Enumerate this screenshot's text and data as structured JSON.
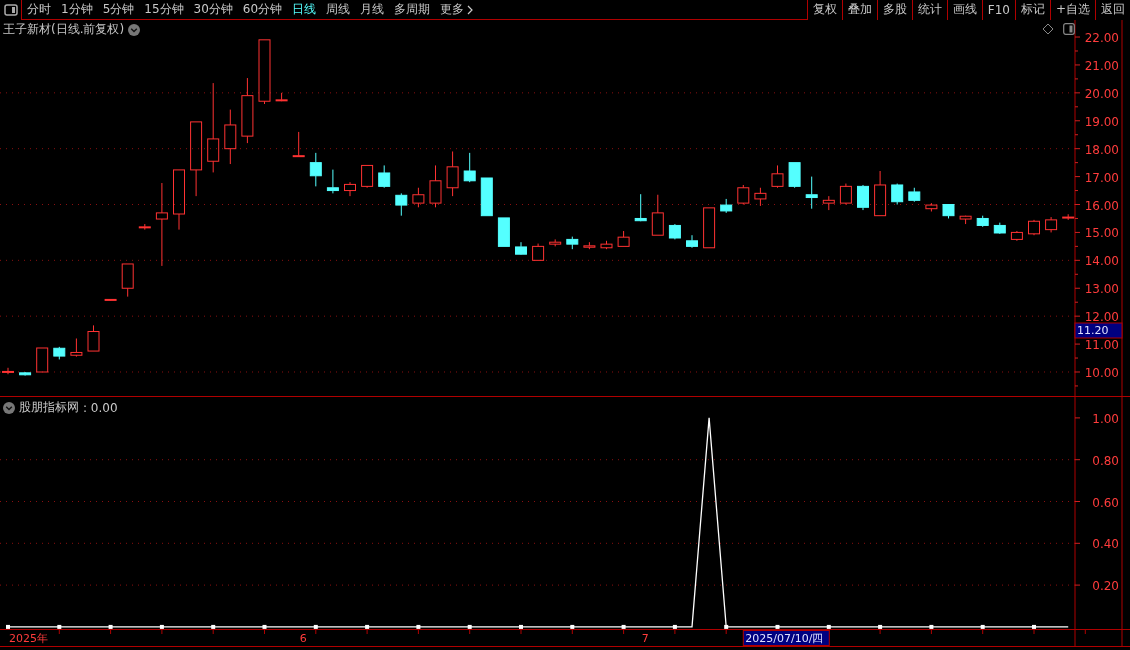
{
  "toolbar": {
    "periods": [
      {
        "label": "分时",
        "selected": false
      },
      {
        "label": "1分钟",
        "selected": false
      },
      {
        "label": "5分钟",
        "selected": false
      },
      {
        "label": "15分钟",
        "selected": false
      },
      {
        "label": "30分钟",
        "selected": false
      },
      {
        "label": "60分钟",
        "selected": false
      },
      {
        "label": "日线",
        "selected": true
      },
      {
        "label": "周线",
        "selected": false
      },
      {
        "label": "月线",
        "selected": false
      },
      {
        "label": "多周期",
        "selected": false
      }
    ],
    "more": "更多",
    "actions": [
      "复权",
      "叠加",
      "多股",
      "统计",
      "画线",
      "F10",
      "标记",
      "+自选",
      "返回"
    ]
  },
  "stock_title": "王子新材(日线.前复权)",
  "price_panel": {
    "cursor_price": "11.20",
    "chart_data": {
      "type": "candlestick",
      "ylim": [
        9.14,
        22.61
      ],
      "grid": true,
      "yticks": [
        {
          "value": 22,
          "label": "22.00"
        },
        {
          "value": 21,
          "label": "21.00"
        },
        {
          "value": 20,
          "label": "20.00"
        },
        {
          "value": 19,
          "label": "19.00"
        },
        {
          "value": 18,
          "label": "18.00"
        },
        {
          "value": 17,
          "label": "17.00"
        },
        {
          "value": 16,
          "label": "16.00"
        },
        {
          "value": 15,
          "label": "15.00"
        },
        {
          "value": 14,
          "label": "14.00"
        },
        {
          "value": 13,
          "label": "13.00"
        },
        {
          "value": 12,
          "label": "12.00"
        },
        {
          "value": 11,
          "label": "11.00"
        },
        {
          "value": 10,
          "label": "10.00"
        }
      ],
      "ohlc": [
        [
          10.02,
          10.15,
          9.92,
          10.02
        ],
        [
          9.97,
          10.0,
          9.87,
          9.9
        ],
        [
          10.0,
          10.86,
          10.0,
          10.86
        ],
        [
          10.85,
          10.9,
          10.45,
          10.57
        ],
        [
          10.6,
          11.2,
          10.55,
          10.7
        ],
        [
          10.75,
          11.67,
          10.75,
          11.45
        ],
        [
          12.6,
          12.6,
          12.6,
          12.6
        ],
        [
          13.0,
          13.87,
          12.7,
          13.87
        ],
        [
          15.2,
          15.3,
          15.1,
          15.2
        ],
        [
          15.48,
          16.77,
          13.8,
          15.7
        ],
        [
          15.66,
          17.24,
          15.1,
          17.24
        ],
        [
          17.24,
          18.96,
          16.3,
          18.96
        ],
        [
          17.55,
          20.35,
          17.15,
          18.35
        ],
        [
          18.0,
          19.4,
          17.45,
          18.85
        ],
        [
          18.45,
          20.53,
          18.2,
          19.9
        ],
        [
          19.7,
          21.9,
          19.6,
          21.9
        ],
        [
          19.75,
          20.0,
          19.7,
          19.75
        ],
        [
          17.75,
          18.6,
          17.75,
          17.75
        ],
        [
          17.5,
          17.85,
          16.65,
          17.03
        ],
        [
          16.6,
          17.25,
          16.4,
          16.5
        ],
        [
          16.5,
          16.8,
          16.3,
          16.72
        ],
        [
          16.65,
          17.4,
          16.6,
          17.4
        ],
        [
          17.13,
          17.4,
          16.6,
          16.65
        ],
        [
          16.33,
          16.4,
          15.6,
          15.98
        ],
        [
          16.05,
          16.6,
          15.9,
          16.35
        ],
        [
          16.05,
          17.4,
          15.9,
          16.85
        ],
        [
          16.6,
          17.9,
          16.3,
          17.35
        ],
        [
          17.2,
          17.85,
          16.8,
          16.85
        ],
        [
          16.95,
          16.95,
          15.6,
          15.6
        ],
        [
          15.52,
          15.52,
          14.5,
          14.5
        ],
        [
          14.48,
          14.65,
          14.2,
          14.22
        ],
        [
          14.0,
          14.6,
          14.0,
          14.5
        ],
        [
          14.58,
          14.75,
          14.5,
          14.65
        ],
        [
          14.75,
          14.85,
          14.4,
          14.58
        ],
        [
          14.47,
          14.65,
          14.4,
          14.52
        ],
        [
          14.45,
          14.7,
          14.4,
          14.58
        ],
        [
          14.5,
          15.05,
          14.5,
          14.83
        ],
        [
          15.5,
          16.37,
          15.4,
          15.42
        ],
        [
          14.9,
          16.35,
          14.9,
          15.7
        ],
        [
          15.25,
          15.3,
          14.75,
          14.8
        ],
        [
          14.7,
          14.9,
          14.45,
          14.5
        ],
        [
          14.45,
          15.88,
          14.45,
          15.88
        ],
        [
          15.98,
          16.2,
          15.7,
          15.77
        ],
        [
          16.05,
          16.7,
          16.0,
          16.6
        ],
        [
          16.2,
          16.6,
          15.95,
          16.4
        ],
        [
          16.65,
          17.4,
          16.6,
          17.1
        ],
        [
          17.5,
          17.5,
          16.6,
          16.65
        ],
        [
          16.35,
          17.0,
          15.85,
          16.25
        ],
        [
          16.05,
          16.3,
          15.8,
          16.15
        ],
        [
          16.05,
          16.75,
          16.0,
          16.65
        ],
        [
          16.65,
          16.7,
          15.8,
          15.9
        ],
        [
          15.6,
          17.2,
          15.6,
          16.7
        ],
        [
          16.7,
          16.75,
          16.0,
          16.1
        ],
        [
          16.45,
          16.6,
          16.1,
          16.15
        ],
        [
          15.85,
          16.05,
          15.75,
          15.98
        ],
        [
          16.0,
          16.0,
          15.5,
          15.6
        ],
        [
          15.48,
          15.6,
          15.3,
          15.58
        ],
        [
          15.5,
          15.6,
          15.2,
          15.25
        ],
        [
          15.25,
          15.35,
          14.95,
          14.98
        ],
        [
          14.75,
          15.05,
          14.7,
          15.0
        ],
        [
          14.95,
          15.45,
          14.9,
          15.4
        ],
        [
          15.1,
          15.55,
          15.0,
          15.45
        ],
        [
          15.55,
          15.65,
          15.45,
          15.55
        ]
      ]
    }
  },
  "indicator_panel": {
    "value": ": 0.00",
    "chart_data": {
      "type": "line",
      "ylim": [
        -0.01,
        1.1
      ],
      "grid": true,
      "yticks": [
        {
          "value": 1,
          "label": "1.00"
        },
        {
          "value": 0.8,
          "label": "0.80"
        },
        {
          "value": 0.6,
          "label": "0.60"
        },
        {
          "value": 0.4,
          "label": "0.40"
        },
        {
          "value": 0.2,
          "label": "0.20"
        }
      ],
      "series": [
        {
          "name": "股朋指标网",
          "color": "#ffffff",
          "values": [
            0,
            0,
            0,
            0,
            0,
            0,
            0,
            0,
            0,
            0,
            0,
            0,
            0,
            0,
            0,
            0,
            0,
            0,
            0,
            0,
            0,
            0,
            0,
            0,
            0,
            0,
            0,
            0,
            0,
            0,
            0,
            0,
            0,
            0,
            0,
            0,
            0,
            0,
            0,
            0,
            0,
            1,
            0,
            0,
            0,
            0,
            0,
            0,
            0,
            0,
            0,
            0,
            0,
            0,
            0,
            0,
            0,
            0,
            0,
            0,
            0,
            0,
            0
          ]
        }
      ]
    }
  },
  "date_axis": [
    "2025年",
    "6",
    "7"
  ],
  "cursor_date": "2025/07/10/四"
}
